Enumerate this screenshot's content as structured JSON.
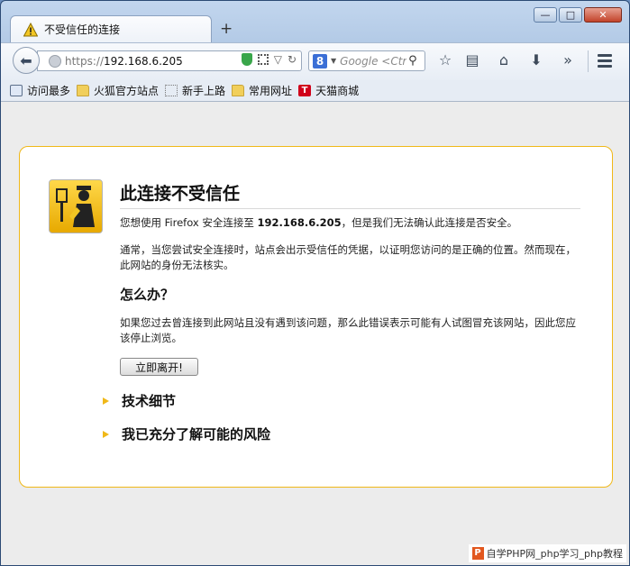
{
  "tab": {
    "title": "不受信任的连接",
    "new_tab_glyph": "+"
  },
  "window_controls": {
    "minimize": "—",
    "maximize": "□",
    "close": "✕"
  },
  "navbar": {
    "url_scheme": "https://",
    "url_host": "192.168.6.205",
    "search_engine_glyph": "8",
    "search_placeholder": "Google <Ctrl+K>"
  },
  "bookmarks": [
    {
      "label": "访问最多",
      "icon": "tv-icon"
    },
    {
      "label": "火狐官方站点",
      "icon": "folder-icon"
    },
    {
      "label": "新手上路",
      "icon": "blank-page-icon"
    },
    {
      "label": "常用网址",
      "icon": "folder-icon"
    },
    {
      "label": "天猫商城",
      "icon": "tmall-icon"
    }
  ],
  "error": {
    "title": "此连接不受信任",
    "p1_prefix": "您想使用 Firefox 安全连接至 ",
    "p1_host": "192.168.6.205",
    "p1_suffix": "，但是我们无法确认此连接是否安全。",
    "p2": "通常，当您尝试安全连接时，站点会出示受信任的凭据，以证明您访问的是正确的位置。然而现在，此网站的身份无法核实。",
    "what_to_do": "怎么办？",
    "p3": "如果您过去曾连接到此网站且没有遇到该问题，那么此错误表示可能有人试图冒充该网站，因此您应该停止浏览。",
    "leave_button": "立即离开!",
    "tech_details": "技术细节",
    "understand_risks": "我已充分了解可能的风险"
  },
  "watermark": {
    "logo": "P",
    "text": "自学PHP网_php学习_php教程"
  },
  "colors": {
    "accent": "#f0b818",
    "titlebar": "#b3cae6",
    "content_bg": "#ececec"
  }
}
